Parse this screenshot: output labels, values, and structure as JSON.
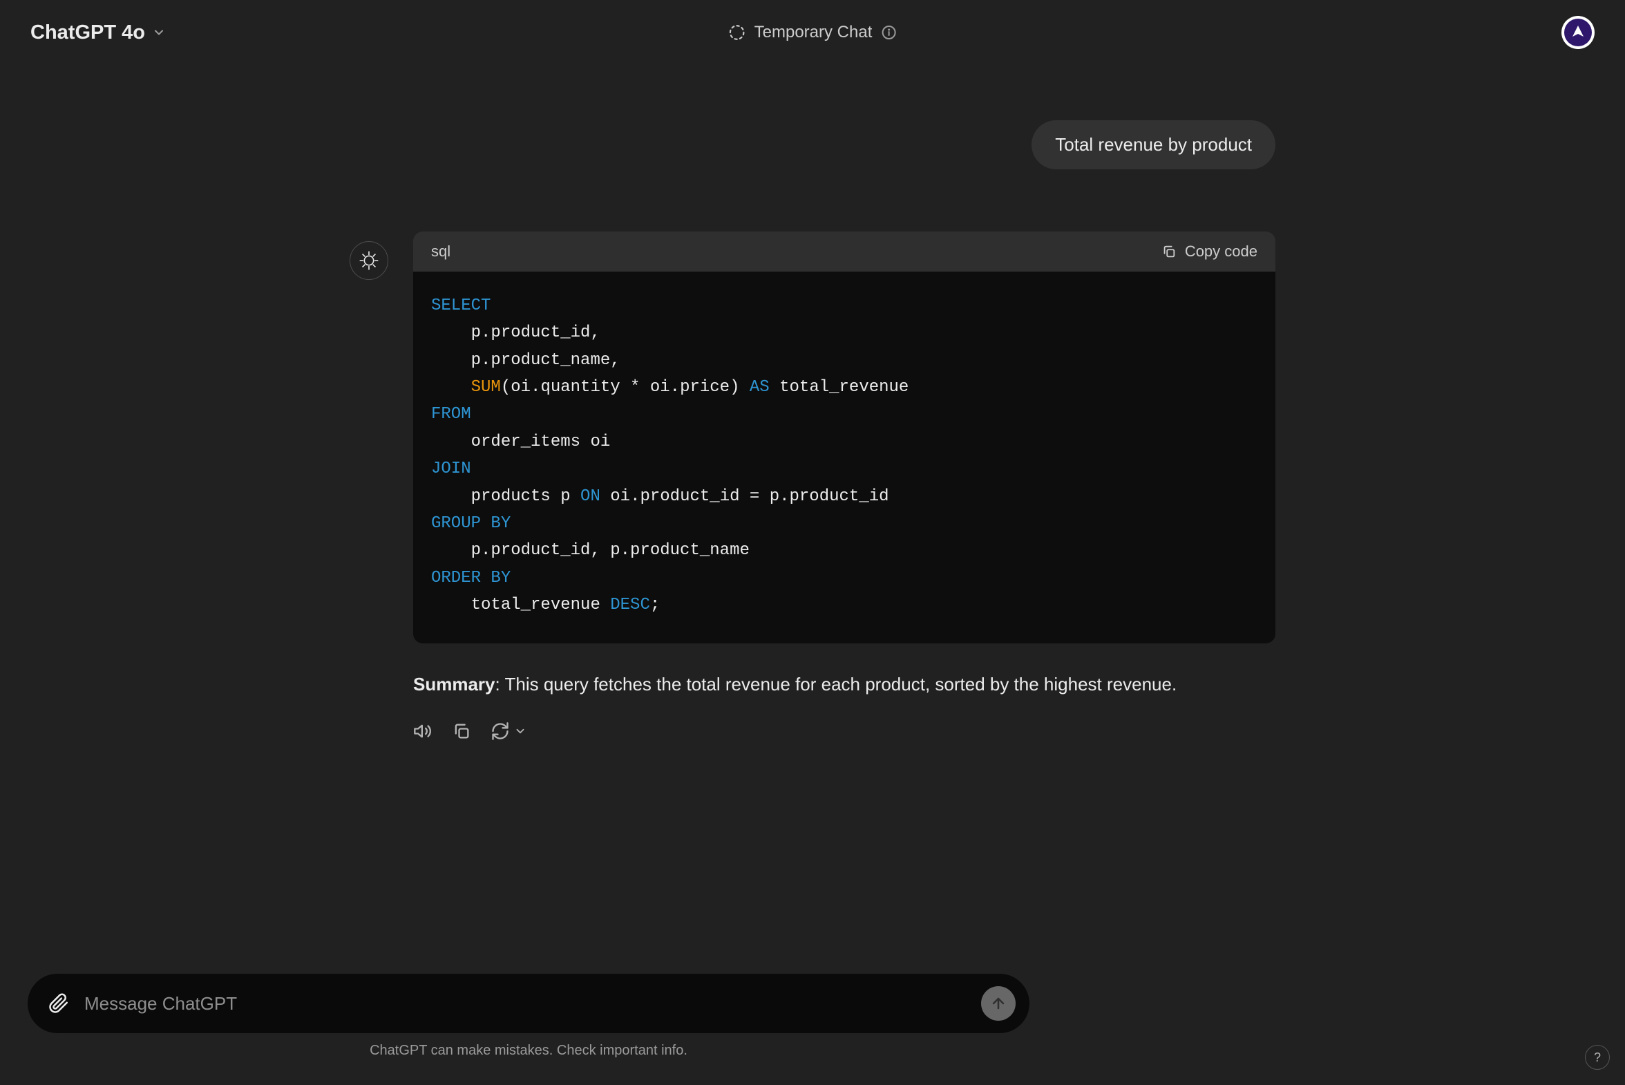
{
  "header": {
    "model_name": "ChatGPT 4o",
    "temp_chat_label": "Temporary Chat"
  },
  "conversation": {
    "user_message": "Total revenue by product",
    "code": {
      "language": "sql",
      "copy_label": "Copy code",
      "tokens": [
        {
          "t": "SELECT",
          "c": "kw-select"
        },
        {
          "t": "\n    p.product_id,\n    p.product_name,\n    ",
          "c": ""
        },
        {
          "t": "SUM",
          "c": "kw-sum"
        },
        {
          "t": "(oi.quantity * oi.price) ",
          "c": ""
        },
        {
          "t": "AS",
          "c": "kw-as"
        },
        {
          "t": " total_revenue\n",
          "c": ""
        },
        {
          "t": "FROM",
          "c": "kw-from"
        },
        {
          "t": "\n    order_items oi\n",
          "c": ""
        },
        {
          "t": "JOIN",
          "c": "kw-join"
        },
        {
          "t": "\n    products p ",
          "c": ""
        },
        {
          "t": "ON",
          "c": "kw-on"
        },
        {
          "t": " oi.product_id = p.product_id\n",
          "c": ""
        },
        {
          "t": "GROUP BY",
          "c": "kw-group"
        },
        {
          "t": "\n    p.product_id, p.product_name\n",
          "c": ""
        },
        {
          "t": "ORDER BY",
          "c": "kw-order"
        },
        {
          "t": "\n    total_revenue ",
          "c": ""
        },
        {
          "t": "DESC",
          "c": "kw-desc"
        },
        {
          "t": ";",
          "c": ""
        }
      ]
    },
    "summary_label": "Summary",
    "summary_text": ": This query fetches the total revenue for each product, sorted by the highest revenue."
  },
  "input": {
    "placeholder": "Message ChatGPT"
  },
  "footer": {
    "note": "ChatGPT can make mistakes. Check important info."
  },
  "help": {
    "label": "?"
  }
}
